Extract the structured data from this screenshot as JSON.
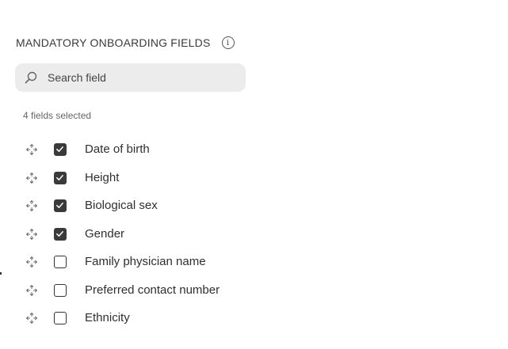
{
  "header": {
    "title": "MANDATORY ONBOARDING FIELDS",
    "info_icon": "info-icon"
  },
  "search": {
    "placeholder": "Search field",
    "value": "",
    "icon": "search-icon"
  },
  "selection": {
    "count_text": "4 fields selected"
  },
  "fields": [
    {
      "label": "Date of birth",
      "checked": true
    },
    {
      "label": "Height",
      "checked": true
    },
    {
      "label": "Biological sex",
      "checked": true
    },
    {
      "label": "Gender",
      "checked": true
    },
    {
      "label": "Family physician name",
      "checked": false
    },
    {
      "label": "Preferred contact number",
      "checked": false
    },
    {
      "label": "Ethnicity",
      "checked": false
    }
  ],
  "colors": {
    "checkbox_fill": "#3a3a3a",
    "search_bg": "#ececec"
  }
}
